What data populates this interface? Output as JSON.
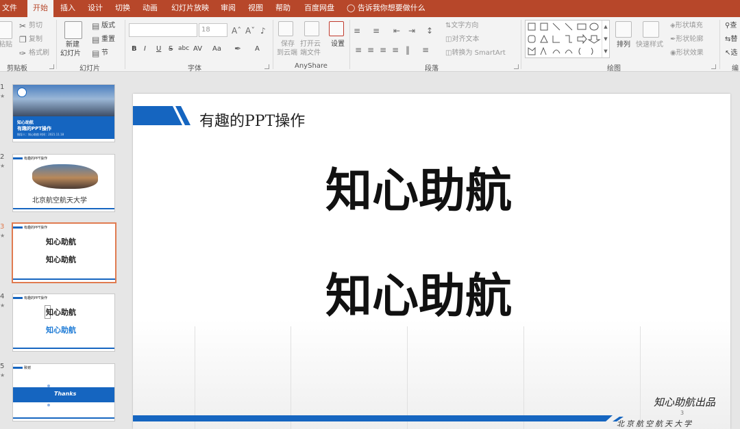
{
  "menu_tabs": [
    "文件",
    "开始",
    "插入",
    "设计",
    "切换",
    "动画",
    "幻灯片放映",
    "审阅",
    "视图",
    "帮助",
    "百度网盘"
  ],
  "active_tab": "开始",
  "tell_me": "告诉我你想要做什么",
  "ribbon": {
    "clipboard": {
      "paste": "粘贴",
      "cut": "剪切",
      "copy": "复制",
      "format_painter": "格式刷",
      "label": "剪贴板"
    },
    "slides": {
      "new_slide": "新建",
      "new_slide2": "幻灯片",
      "layout": "版式",
      "reset": "重置",
      "section": "节",
      "label": "幻灯片"
    },
    "font": {
      "size": "18",
      "bold": "B",
      "italic": "I",
      "underline": "U",
      "strike": "S",
      "shadow": "abc",
      "spacing": "AV",
      "case": "Aa",
      "color": "A",
      "label": "字体"
    },
    "anyshare": {
      "save_cloud_1": "保存",
      "save_cloud_2": "到云端",
      "open_cloud_1": "打开云",
      "open_cloud_2": "端文件",
      "settings": "设置",
      "label": "AnyShare"
    },
    "paragraph": {
      "text_direction": "文字方向",
      "align_text": "对齐文本",
      "smartart": "转换为 SmartArt",
      "label": "段落"
    },
    "drawing": {
      "arrange": "排列",
      "quick_styles": "快速样式",
      "shape_fill": "形状填充",
      "shape_outline": "形状轮廓",
      "shape_effects": "形状效果",
      "label": "绘图"
    },
    "editing": {
      "find": "查",
      "replace": "替",
      "select": "选",
      "label": "编"
    }
  },
  "slides": [
    {
      "num": "1",
      "title1": "知心助航",
      "title2": "有趣的PPT操作",
      "meta": "指导人：知心助航  时间：2021.11.18"
    },
    {
      "num": "2",
      "header": "有趣的PPT操作",
      "caption": "北京航空航天大学"
    },
    {
      "num": "3",
      "header": "有趣的PPT操作",
      "line1": "知心助航",
      "line2": "知心助航"
    },
    {
      "num": "4",
      "header": "有趣的PPT操作",
      "line1": "知心助航",
      "line2": "知心助航"
    },
    {
      "num": "5",
      "header": "致谢",
      "thanks": "Thanks"
    }
  ],
  "current": {
    "title": "有趣的PPT操作",
    "text1": "知心助航",
    "text2": "知心助航",
    "signature": "知心助航出品",
    "page": "3",
    "school": "北京航空航天大学"
  },
  "colors": {
    "brand": "#b7472a",
    "blue": "#1565c0",
    "selection": "#e07a4f"
  }
}
